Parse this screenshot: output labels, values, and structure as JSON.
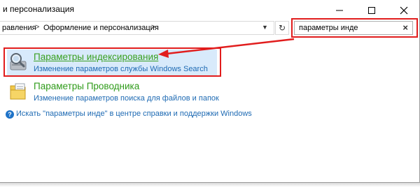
{
  "window": {
    "title": "и персонализация",
    "controls": {
      "minimize": "minimize",
      "maximize": "maximize",
      "close": "close"
    }
  },
  "address_bar": {
    "crumbs": [
      "равления",
      "Оформление и персонализация"
    ],
    "separator": ">"
  },
  "search": {
    "value": "параметры инде",
    "clear_glyph": "×"
  },
  "results": [
    {
      "title": "Параметры индексирования",
      "description": "Изменение параметров службы Windows Search",
      "icon": "indexing-options-icon",
      "title_color": "#3aa021",
      "selected": true
    },
    {
      "title": "Параметры Проводника",
      "description": "Изменение параметров поиска для файлов и папок",
      "icon": "folder-options-icon",
      "title_color": "#2f9b1a",
      "selected": false
    }
  ],
  "help_link": {
    "text": "Искать \"параметры инде\" в центре справки и поддержки Windows",
    "icon_glyph": "?"
  },
  "colors": {
    "annotation_red": "#e11d1d",
    "link_blue": "#1e6ab3",
    "selection_bg": "#d8eafb"
  }
}
